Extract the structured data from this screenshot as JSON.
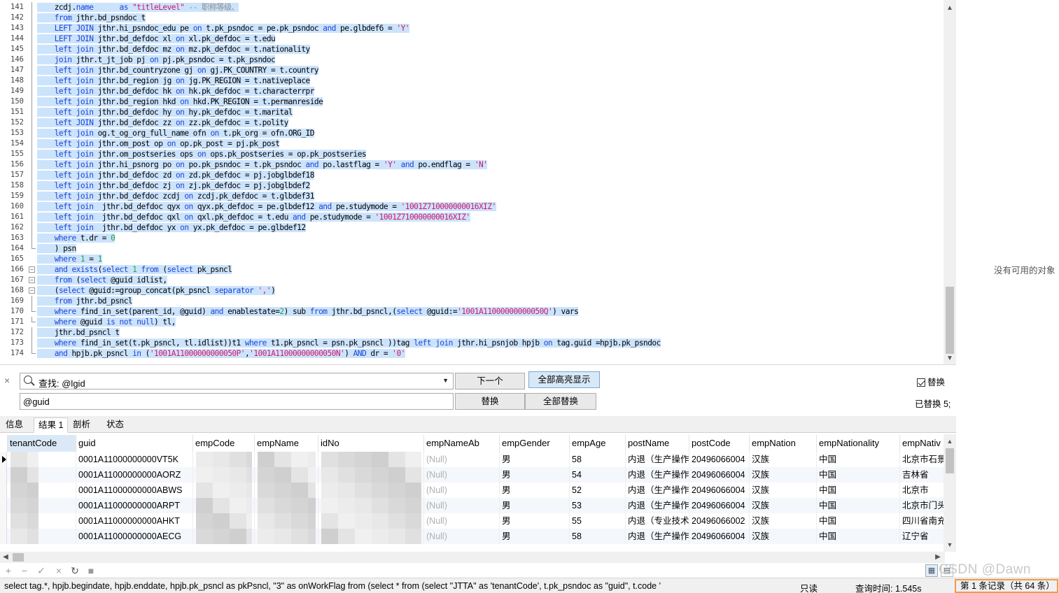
{
  "editor": {
    "lines": [
      {
        "n": "141",
        "html": "    zcdj.<span class=\"kw\">name</span>      <span class=\"kw\">as</span> <span class=\"str\">\"titleLevel\"</span> <span class=\"cmt\">-- 职称等级、</span>",
        "fold": "line"
      },
      {
        "n": "142",
        "html": "    <span class=\"kw\">from</span> jthr.bd_psndoc t",
        "fold": "line"
      },
      {
        "n": "143",
        "html": "    <span class=\"kw\">LEFT JOIN</span> jthr.hi_psndoc_edu pe <span class=\"kw\">on</span> t.pk_psndoc = pe.pk_psndoc <span class=\"kw\">and</span> pe.glbdef6 = <span class=\"str\">'Y'</span>",
        "fold": "line"
      },
      {
        "n": "144",
        "html": "    <span class=\"kw\">LEFT JOIN</span> jthr.bd_defdoc xl <span class=\"kw\">on</span> xl.pk_defdoc = t.edu",
        "fold": "line"
      },
      {
        "n": "145",
        "html": "    <span class=\"kw\">left join</span> jthr.bd_defdoc mz <span class=\"kw\">on</span> mz.pk_defdoc = t.nationality",
        "fold": "line"
      },
      {
        "n": "146",
        "html": "    <span class=\"kw\">join</span> jthr.t_jt_job pj <span class=\"kw\">on</span> pj.pk_psndoc = t.pk_psndoc",
        "fold": "line"
      },
      {
        "n": "147",
        "html": "    <span class=\"kw\">left join</span> jthr.bd_countryzone gj <span class=\"kw\">on</span> gj.PK_COUNTRY = t.country",
        "fold": "line"
      },
      {
        "n": "148",
        "html": "    <span class=\"kw\">left join</span> jthr.bd_region jg <span class=\"kw\">on</span> jg.PK_REGION = t.nativeplace",
        "fold": "line"
      },
      {
        "n": "149",
        "html": "    <span class=\"kw\">left join</span> jthr.bd_defdoc hk <span class=\"kw\">on</span> hk.pk_defdoc = t.characterrpr",
        "fold": "line"
      },
      {
        "n": "150",
        "html": "    <span class=\"kw\">left join</span> jthr.bd_region hkd <span class=\"kw\">on</span> hkd.PK_REGION = t.permanreside",
        "fold": "line"
      },
      {
        "n": "151",
        "html": "    <span class=\"kw\">left join</span> jthr.bd_defdoc hy <span class=\"kw\">on</span> hy.pk_defdoc = t.marital",
        "fold": "line"
      },
      {
        "n": "152",
        "html": "    <span class=\"kw\">left JOIN</span> jthr.bd_defdoc zz <span class=\"kw\">on</span> zz.pk_defdoc = t.polity",
        "fold": "line"
      },
      {
        "n": "153",
        "html": "    <span class=\"kw\">left join</span> og.t_og_org_full_name ofn <span class=\"kw\">on</span> t.pk_org = ofn.ORG_ID",
        "fold": "line"
      },
      {
        "n": "154",
        "html": "    <span class=\"kw\">left join</span> jthr.om_post op <span class=\"kw\">on</span> op.pk_post = pj.pk_post",
        "fold": "line"
      },
      {
        "n": "155",
        "html": "    <span class=\"kw\">left join</span> jthr.om_postseries ops <span class=\"kw\">on</span> ops.pk_postseries = op.pk_postseries",
        "fold": "line"
      },
      {
        "n": "156",
        "html": "    <span class=\"kw\">left join</span> jthr.hi_psnorg po <span class=\"kw\">on</span> po.pk_psndoc = t.pk_psndoc <span class=\"kw\">and</span> po.lastflag = <span class=\"str\">'Y'</span> <span class=\"kw\">and</span> po.endflag = <span class=\"str\">'N'</span>",
        "fold": "line"
      },
      {
        "n": "157",
        "html": "    <span class=\"kw\">left join</span> jthr.bd_defdoc zd <span class=\"kw\">on</span> zd.pk_defdoc = pj.jobglbdef18",
        "fold": "line"
      },
      {
        "n": "158",
        "html": "    <span class=\"kw\">left join</span> jthr.bd_defdoc zj <span class=\"kw\">on</span> zj.pk_defdoc = pj.jobglbdef2",
        "fold": "line"
      },
      {
        "n": "159",
        "html": "    <span class=\"kw\">left join</span> jthr.bd_defdoc zcdj <span class=\"kw\">on</span> zcdj.pk_defdoc = t.glbdef31",
        "fold": "line"
      },
      {
        "n": "160",
        "html": "    <span class=\"kw\">left join</span>  jthr.bd_defdoc qyx <span class=\"kw\">on</span> qyx.pk_defdoc = pe.glbdef12 <span class=\"kw\">and</span> pe.studymode = <span class=\"str\">'1001Z710000000016XIZ'</span>",
        "fold": "line"
      },
      {
        "n": "161",
        "html": "    <span class=\"kw\">left join</span>  jthr.bd_defdoc qxl <span class=\"kw\">on</span> qxl.pk_defdoc = t.edu <span class=\"kw\">and</span> pe.studymode = <span class=\"str\">'1001Z710000000016XIZ'</span>",
        "fold": "line"
      },
      {
        "n": "162",
        "html": "    <span class=\"kw\">left join</span>  jthr.bd_defdoc yx <span class=\"kw\">on</span> yx.pk_defdoc = pe.glbdef12",
        "fold": "line"
      },
      {
        "n": "163",
        "html": "    <span class=\"kw\">where</span> t.dr = <span class=\"num\">0</span>",
        "fold": "line"
      },
      {
        "n": "164",
        "html": "    ) psn",
        "fold": "end"
      },
      {
        "n": "165",
        "html": "    <span class=\"kw\">where</span> <span class=\"num\">1</span> = <span class=\"num\">1</span>",
        "fold": "none"
      },
      {
        "n": "166",
        "html": "    <span class=\"kw\">and exists</span>(<span class=\"kw\">select</span> <span class=\"num\">1</span> <span class=\"kw\">from</span> (<span class=\"kw\">select</span> pk_psncl",
        "fold": "box"
      },
      {
        "n": "167",
        "html": "    <span class=\"kw\">from</span> (<span class=\"kw\">select</span> @guid idlist,",
        "fold": "box"
      },
      {
        "n": "168",
        "html": "    (<span class=\"kw\">select</span> @guid:=group_concat(pk_psncl <span class=\"kw\">separator</span> <span class=\"str\">','</span>)",
        "fold": "box"
      },
      {
        "n": "169",
        "html": "    <span class=\"kw\">from</span> jthr.bd_psncl",
        "fold": "line"
      },
      {
        "n": "170",
        "html": "    <span class=\"kw\">where</span> find_in_set(parent_id, @guid) <span class=\"kw\">and</span> enablestate=<span class=\"num\">2</span>) sub <span class=\"kw\">from</span> jthr.bd_psncl,(<span class=\"kw\">select</span> @guid:=<span class=\"str\">'1001A11000000000050Q'</span>) vars",
        "fold": "end"
      },
      {
        "n": "171",
        "html": "    <span class=\"kw\">where</span> @guid <span class=\"kw\">is not null</span>) tl,",
        "fold": "end"
      },
      {
        "n": "172",
        "html": "    jthr.bd_psncl t",
        "fold": "line"
      },
      {
        "n": "173",
        "html": "    <span class=\"kw\">where</span> find_in_set(t.pk_psncl, tl.idlist))t1 <span class=\"kw\">where</span> t1.pk_psncl = psn.pk_psncl ))tag <span class=\"kw\">left join</span> jthr.hi_psnjob hpjb <span class=\"kw\">on</span> tag.guid =hpjb.pk_psndoc",
        "fold": "line"
      },
      {
        "n": "174",
        "html": "    <span class=\"kw\">and</span> hpjb.pk_psncl <span class=\"kw\">in</span> (<span class=\"str\">'1001A11000000000050P'</span>,<span class=\"str\">'1001A11000000000050N'</span>) <span class=\"kw\">AND</span> dr = <span class=\"str\">'0'</span>",
        "fold": "end"
      }
    ]
  },
  "find": {
    "label_prefix": "查找: ",
    "query": "@lgid",
    "next_button": "下一个",
    "highlight_all_button": "全部高亮显示",
    "replace_value": "@guid",
    "replace_button": "替换",
    "replace_all_button": "全部替换",
    "replace_toggle_label": "替换",
    "replaced_status": "已替换 5;"
  },
  "tabs": [
    "信息",
    "结果 1",
    "剖析",
    "状态"
  ],
  "grid": {
    "columns": [
      "tenantCode",
      "guid",
      "empCode",
      "empName",
      "idNo",
      "empNameAb",
      "empGender",
      "empAge",
      "postName",
      "postCode",
      "empNation",
      "empNationality",
      "empNativ"
    ],
    "rows": [
      [
        "",
        "0001A11000000000VT5K",
        "",
        "",
        "",
        "(Null)",
        "男",
        "58",
        "内退（生产操作)",
        "20496066004",
        "汉族",
        "中国",
        "北京市石景"
      ],
      [
        "",
        "0001A11000000000AORZ",
        "",
        "",
        "",
        "(Null)",
        "男",
        "54",
        "内退（生产操作)",
        "20496066004",
        "汉族",
        "中国",
        "吉林省"
      ],
      [
        "",
        "0001A11000000000ABWS",
        "",
        "",
        "",
        "(Null)",
        "男",
        "52",
        "内退（生产操作)",
        "20496066004",
        "汉族",
        "中国",
        "北京市"
      ],
      [
        "",
        "0001A11000000000ARPT",
        "",
        "",
        "",
        "(Null)",
        "男",
        "53",
        "内退（生产操作)",
        "20496066004",
        "汉族",
        "中国",
        "北京市门头"
      ],
      [
        "",
        "0001A11000000000AHKT",
        "",
        "",
        "",
        "(Null)",
        "男",
        "55",
        "内退（专业技术)",
        "20496066002",
        "汉族",
        "中国",
        "四川省南充"
      ],
      [
        "",
        "0001A11000000000AECG",
        "",
        "",
        "",
        "(Null)",
        "男",
        "58",
        "内退（生产操作)",
        "20496066004",
        "汉族",
        "中国",
        "辽宁省"
      ]
    ]
  },
  "toolbar_icons": [
    "add-icon",
    "remove-icon",
    "apply-icon",
    "cancel-icon",
    "refresh-icon",
    "stop-icon",
    "grid-view-icon",
    "form-view-icon"
  ],
  "status": {
    "sql": "select tag.*,    hpjb.begindate,    hpjb.enddate,    hpjb.pk_psncl as pkPsncl,    \"3\" as onWorkFlag    from    (select *    from (select \"JTTA\" as 'tenantCode',    t.pk_psndoc as \"guid\",    t.code '",
    "readonly": "只读",
    "query_time": "查询时间: 1.545s",
    "record_count": "第 1 条记录（共 64 条）"
  },
  "side": {
    "no_object": "没有可用的对象"
  },
  "watermark": "CSDN @Dawn"
}
